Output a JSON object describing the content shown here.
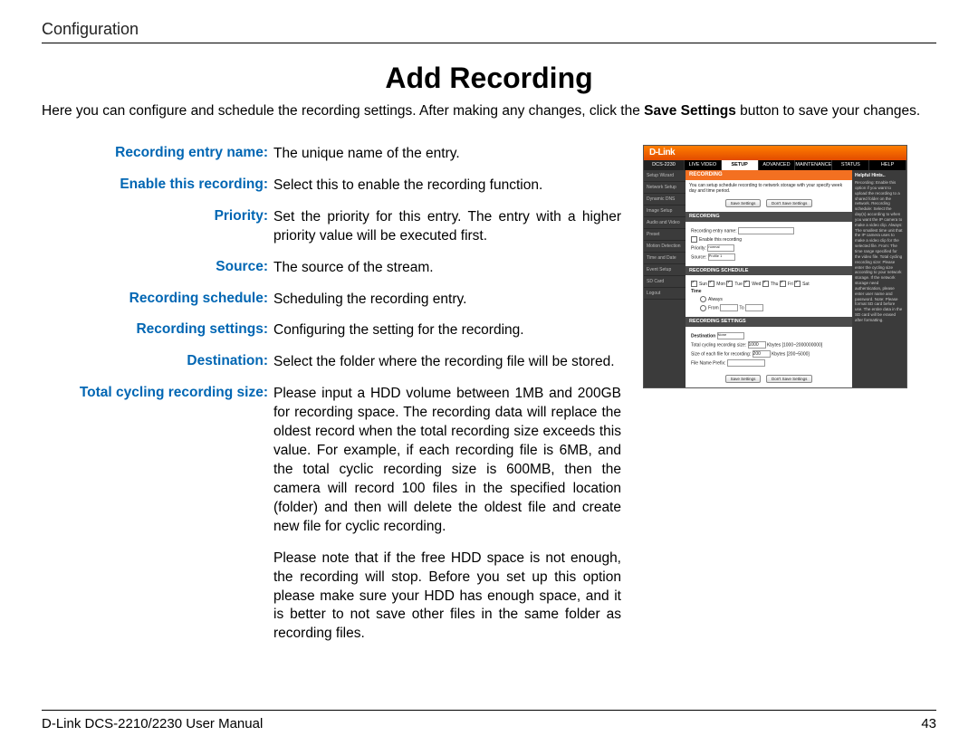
{
  "sectionHeader": "Configuration",
  "title": "Add Recording",
  "intro_a": "Here you can configure and schedule the recording settings. After making any changes, click the ",
  "intro_bold": "Save Settings",
  "intro_b": " button to save your changes.",
  "defs": {
    "entryName": {
      "label": "Recording entry name",
      "value": "The unique name of the entry."
    },
    "enable": {
      "label": "Enable this recording",
      "value": "Select this to enable the recording function."
    },
    "priority": {
      "label": "Priority",
      "value": "Set the priority for this entry. The entry with a higher priority value will be executed first."
    },
    "source": {
      "label": "Source",
      "value": "The source of the stream."
    },
    "schedule": {
      "label": "Recording schedule",
      "value": "Scheduling the recording entry."
    },
    "settings": {
      "label": "Recording settings",
      "value": "Configuring the setting for the recording."
    },
    "dest": {
      "label": "Destination",
      "value": "Select the folder where the recording file will be stored."
    },
    "cycling": {
      "label": "Total cycling recording size",
      "p1": "Please input a HDD volume between 1MB and 200GB for recording space. The recording data will replace the oldest record when the total recording size exceeds this value. For example, if each recording file is 6MB, and the total cyclic recording size is 600MB, then the camera will record 100 files in the specified location (folder) and then will delete the oldest file and create new file for cyclic recording.",
      "p2": "Please note that if the free HDD space is not enough, the recording will stop. Before you set up this option please make sure your HDD has enough space, and it is better to not save other files in the same folder as recording files."
    }
  },
  "shot": {
    "logo": "D-Link",
    "model": "DCS-2230",
    "tabs": [
      "LIVE VIDEO",
      "SETUP",
      "ADVANCED",
      "MAINTENANCE",
      "STATUS",
      "HELP"
    ],
    "activeTab": "SETUP",
    "sidenav": [
      "Setup Wizard",
      "Network Setup",
      "Dynamic DNS",
      "Image Setup",
      "Audio and Video",
      "Preset",
      "Motion Detection",
      "Time and Date",
      "Event Setup",
      "SD Card",
      "Logout"
    ],
    "hintsTitle": "Helpful Hints..",
    "hintsBody": "Recording: Enable this option if you want to upload the recording to a shared folder on the network.\n\nRecording schedule: Select the day(s) according to when you want the IP camera to make a video clip.\n\nAlways: The smallest time unit that the IP camera uses to make a video clip for the selected file.\n\nFrom: The time range specified for the video file.\n\nTotal cycling recording size: Please enter the cycling size according to your network storage. If the network storage need authentication, please enter user name and password.\n\nNote: Please format SD card before use. The entire data in the SD card will be erased after formatting.",
    "panels": {
      "recordingTitle": "RECORDING",
      "desc": "You can setup schedule recording to network storage with your specify week day and time period.",
      "saveBtn": "Save Settings",
      "dontSaveBtn": "Don't Save Settings",
      "recBar": "RECORDING",
      "entryLabel": "Recording entry name:",
      "enableLabel": "Enable this recording",
      "priorityLabel": "Priority:",
      "priorityVal": "normal",
      "sourceLabel": "Source:",
      "sourceVal": "Profile 1",
      "schedBar": "RECORDING SCHEDULE",
      "days": [
        "Sun",
        "Mon",
        "Tue",
        "Wed",
        "Thu",
        "Fri",
        "Sat"
      ],
      "timeLabel": "Time",
      "always": "Always",
      "from": "From",
      "to": "To",
      "setBar": "RECORDING SETTINGS",
      "destLabel": "Destination",
      "destVal": "None",
      "cycLabel": "Total cycling recording size:",
      "cycVal": "1000",
      "cycUnit": "Kbytes [1000~2000000000]",
      "eachLabel": "Size of each file for recording:",
      "eachVal": "200",
      "eachUnit": "Kbytes [200~5000]",
      "prefixLabel": "File Name Prefix:"
    }
  },
  "footer": {
    "left": "D-Link DCS-2210/2230 User Manual",
    "right": "43"
  }
}
